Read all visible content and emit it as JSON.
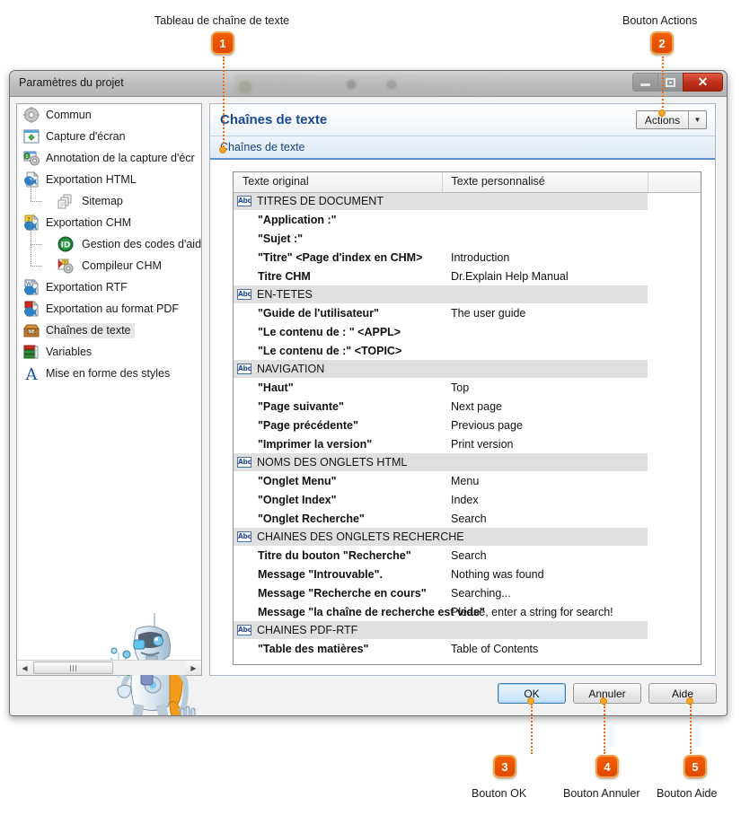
{
  "callouts": [
    {
      "n": "1",
      "label": "Tableau de chaîne de texte"
    },
    {
      "n": "2",
      "label": "Bouton Actions"
    },
    {
      "n": "3",
      "label": "Bouton OK"
    },
    {
      "n": "4",
      "label": "Bouton Annuler"
    },
    {
      "n": "5",
      "label": "Bouton Aide"
    }
  ],
  "window": {
    "title": "Paramètres du projet",
    "controls": {
      "minimize": "minimize-icon",
      "restore": "restore-icon",
      "close": "✕"
    }
  },
  "sidebar": {
    "items": [
      {
        "label": "Commun",
        "icon": "gear-icon",
        "level": 0,
        "selected": false
      },
      {
        "label": "Capture d'écran",
        "icon": "screen-capture-icon",
        "level": 0,
        "selected": false
      },
      {
        "label": "Annotation de la capture d'écr",
        "icon": "annotation-icon",
        "level": 0,
        "selected": false
      },
      {
        "label": "Exportation HTML",
        "icon": "html-export-icon",
        "level": 0,
        "selected": false
      },
      {
        "label": "Sitemap",
        "icon": "sitemap-icon",
        "level": 1,
        "selected": false
      },
      {
        "label": "Exportation CHM",
        "icon": "chm-export-icon",
        "level": 0,
        "selected": false
      },
      {
        "label": "Gestion des codes d'aide",
        "icon": "help-id-icon",
        "level": 1,
        "selected": false
      },
      {
        "label": "Compileur CHM",
        "icon": "chm-compiler-icon",
        "level": 1,
        "selected": false
      },
      {
        "label": "Exportation RTF",
        "icon": "rtf-export-icon",
        "level": 0,
        "selected": false
      },
      {
        "label": "Exportation au format PDF",
        "icon": "pdf-export-icon",
        "level": 0,
        "selected": false
      },
      {
        "label": "Chaînes de texte",
        "icon": "text-strings-icon",
        "level": 0,
        "selected": true
      },
      {
        "label": "Variables",
        "icon": "variables-icon",
        "level": 0,
        "selected": false
      },
      {
        "label": "Mise en forme des styles",
        "icon": "styles-icon",
        "level": 0,
        "selected": false
      }
    ],
    "scrollbar": {
      "left_arrow": "◀",
      "right_arrow": "▶"
    }
  },
  "content": {
    "title": "Chaînes de texte",
    "actions_button": {
      "label": "Actions",
      "arrow": "▼"
    },
    "breadcrumb": "Chaînes de texte",
    "table": {
      "headers": [
        "Texte original",
        "Texte personnalisé",
        ""
      ],
      "rows": [
        {
          "type": "group",
          "original": "TITRES DE DOCUMENT",
          "custom": ""
        },
        {
          "type": "row",
          "original": "\"Application :\"",
          "custom": ""
        },
        {
          "type": "row",
          "original": "\"Sujet :\"",
          "custom": ""
        },
        {
          "type": "row",
          "original": "\"Titre\" <Page d'index en CHM>",
          "custom": "Introduction"
        },
        {
          "type": "row",
          "original": "Titre CHM",
          "custom": "Dr.Explain Help Manual"
        },
        {
          "type": "group",
          "original": "EN-TETES",
          "custom": ""
        },
        {
          "type": "row",
          "original": "\"Guide de l'utilisateur\"",
          "custom": "The user guide"
        },
        {
          "type": "row",
          "original": "\"Le contenu de : \" <APPL>",
          "custom": ""
        },
        {
          "type": "row",
          "original": "\"Le contenu de :\" <TOPIC>",
          "custom": ""
        },
        {
          "type": "group",
          "original": "NAVIGATION",
          "custom": ""
        },
        {
          "type": "row",
          "original": "\"Haut\"",
          "custom": "Top"
        },
        {
          "type": "row",
          "original": "\"Page suivante\"",
          "custom": "Next page"
        },
        {
          "type": "row",
          "original": "\"Page précédente\"",
          "custom": "Previous page"
        },
        {
          "type": "row",
          "original": "\"Imprimer la version\"",
          "custom": "Print version"
        },
        {
          "type": "group",
          "original": "NOMS DES ONGLETS HTML",
          "custom": ""
        },
        {
          "type": "row",
          "original": "\"Onglet Menu\"",
          "custom": "Menu"
        },
        {
          "type": "row",
          "original": "\"Onglet Index\"",
          "custom": "Index"
        },
        {
          "type": "row",
          "original": "\"Onglet Recherche\"",
          "custom": "Search"
        },
        {
          "type": "group",
          "original": "CHAINES DES ONGLETS RECHERCHE",
          "custom": ""
        },
        {
          "type": "row",
          "original": "Titre du bouton \"Recherche\"",
          "custom": "Search"
        },
        {
          "type": "row",
          "original": "Message \"Introuvable\".",
          "custom": "Nothing was found"
        },
        {
          "type": "row",
          "original": "Message \"Recherche en cours\"",
          "custom": "Searching..."
        },
        {
          "type": "row",
          "original": "Message \"la chaîne de recherche est vide\"",
          "custom": "Please, enter a string for search!"
        },
        {
          "type": "group",
          "original": "CHAINES PDF-RTF",
          "custom": ""
        },
        {
          "type": "row",
          "original": "\"Table des matières\"",
          "custom": "Table of Contents"
        }
      ]
    }
  },
  "footer": {
    "ok": "OK",
    "cancel": "Annuler",
    "help": "Aide"
  },
  "colors": {
    "accent_orange": "#ef5f08",
    "title_blue": "#1b4a8e",
    "group_row": "#e0e0e0"
  }
}
